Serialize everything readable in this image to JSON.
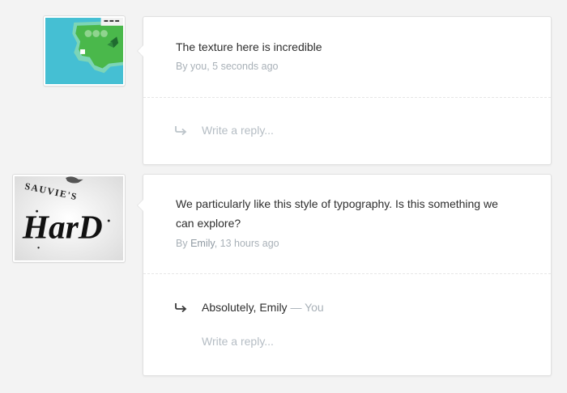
{
  "comments": [
    {
      "thumbnail_icon": "map-thumbnail-icon",
      "text": "The texture here is incredible",
      "author": "By you",
      "time": ", 5 seconds ago",
      "reply_placeholder": "Write a reply..."
    },
    {
      "thumbnail_icon": "typography-thumbnail-icon",
      "thumbnail_lettering": [
        "SAUVIE'S",
        "HarD"
      ],
      "text": "We particularly like this style of typography. Is this something we can explore?",
      "author_prefix": "By ",
      "author": "Emily",
      "time": ", 13 hours ago",
      "reply": {
        "text": "Absolutely, Emily",
        "author": " — You"
      },
      "reply_placeholder": "Write a reply..."
    }
  ],
  "colors": {
    "background": "#f3f3f3",
    "card": "#ffffff",
    "text": "#2e2e2e",
    "muted": "#a9b1b8",
    "map_water": "#45bfd3",
    "map_land": "#4ab84b"
  },
  "icons": {
    "reply": "reply-arrow-icon"
  }
}
